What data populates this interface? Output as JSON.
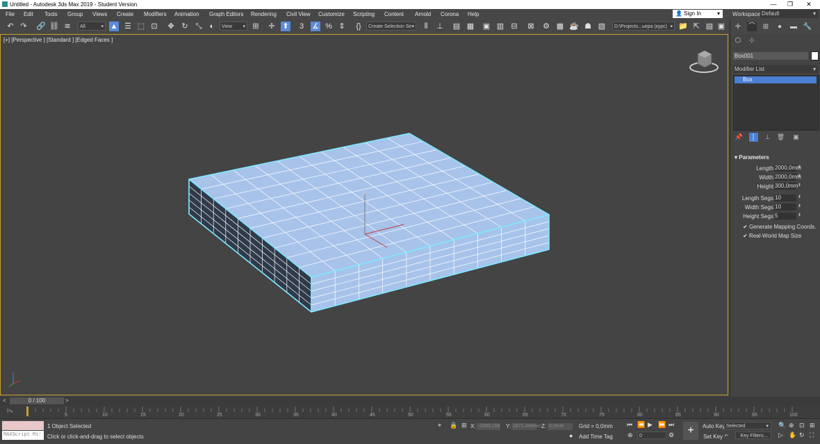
{
  "window": {
    "title": "Untitled - Autodesk 3ds Max 2019 - Student Version",
    "minimize": "—",
    "restore": "❐",
    "close": "✕"
  },
  "menu": {
    "items": [
      "File",
      "Edit",
      "Tools",
      "Group",
      "Views",
      "Create",
      "Modifiers",
      "Animation",
      "Graph Editors",
      "Rendering",
      "Civil View",
      "Customize",
      "Scripting",
      "Content",
      "Arnold",
      "Corona",
      "Help"
    ],
    "sign_in": "Sign In",
    "workspaces_label": "Workspaces:",
    "workspaces_value": "Default"
  },
  "toolbar": {
    "selection_filter": "All",
    "reference_coord": "View",
    "named_selection": "Create Selection Se",
    "project_path": "D:\\Projects...ьера (курс)"
  },
  "viewport": {
    "label": "[+] [Perspective ] [Standard ] [Edged Faces ]",
    "gizmo_z": "z",
    "object_color": "#a7c3ea",
    "edge_color": "#7fe8ff"
  },
  "command_panel": {
    "object_name": "Box001",
    "modifier_list": "Modifier List",
    "stack": [
      "Box"
    ],
    "rollout_title": "Parameters",
    "params": [
      {
        "label": "Length:",
        "value": "2000,0mm"
      },
      {
        "label": "Width:",
        "value": "2000,0mm"
      },
      {
        "label": "Height:",
        "value": "300,0mm"
      },
      {
        "label": "Length Segs:",
        "value": "10"
      },
      {
        "label": "Width Segs:",
        "value": "10"
      },
      {
        "label": "Height Segs:",
        "value": "5"
      }
    ],
    "checkboxes": [
      {
        "label": "Generate Mapping Coords.",
        "checked": true
      },
      {
        "label": "Real-World Map Size",
        "checked": true
      }
    ]
  },
  "timeline": {
    "frame_indicator": "0 / 100",
    "prev": "<",
    "next": ">",
    "ticks": [
      "5",
      "10",
      "15",
      "20",
      "25",
      "30",
      "35",
      "40",
      "45",
      "50",
      "55",
      "60",
      "65",
      "70",
      "75",
      "80",
      "85",
      "90",
      "95",
      "100"
    ]
  },
  "status": {
    "maxscript_placeholder": "MAXScript Mi:",
    "selection_info": "1 Object Selected",
    "prompt": "Click or click-and-drag to select objects",
    "x_label": "X:",
    "x_value": "-3289,198",
    "y_label": "Y:",
    "y_value": "1871,449mm",
    "z_label": "Z:",
    "z_value": "0,0mm",
    "grid": "Grid = 0,0mm",
    "add_time_tag": "Add Time Tag",
    "auto_key": "Auto Key",
    "set_key": "Set Key",
    "key_mode": "Selected",
    "key_filters": "Key Filters...",
    "current_frame": "0"
  }
}
